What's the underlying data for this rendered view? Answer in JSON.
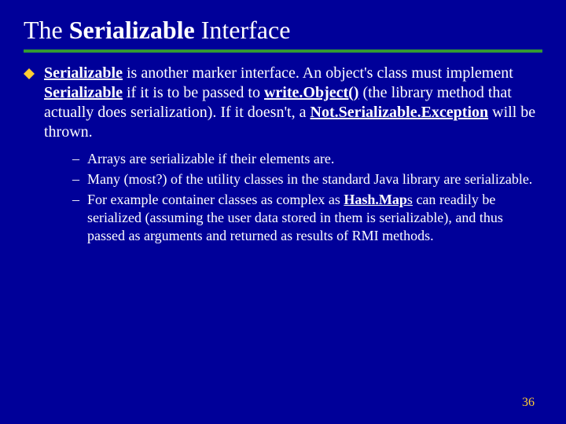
{
  "title_pre": "The ",
  "title_bold": "Serializable",
  "title_post": " Interface",
  "main": {
    "p1_b1": "Serializable",
    "p1_t1": " is another marker interface.  An object's class must implement ",
    "p1_b2": "Serializable",
    "p1_t2": " if it is to be passed to ",
    "p1_b3": "write.Object()",
    "p1_t3": "  (the library method that actually does serialization).  If it doesn't, a ",
    "p1_b4": "Not.Serializable.Exception",
    "p1_t4": " will be thrown."
  },
  "sub": [
    "Arrays are serializable if their elements are.",
    "Many (most?) of the utility classes in the standard Java library are serializable."
  ],
  "sub3_pre": "For example container classes as complex as ",
  "sub3_bold": "Hash.Map",
  "sub3_post": "s can readily be serialized (assuming the user data stored in them is serializable), and thus passed as arguments and returned as results of RMI methods.",
  "dash": "–",
  "page_number": "36"
}
